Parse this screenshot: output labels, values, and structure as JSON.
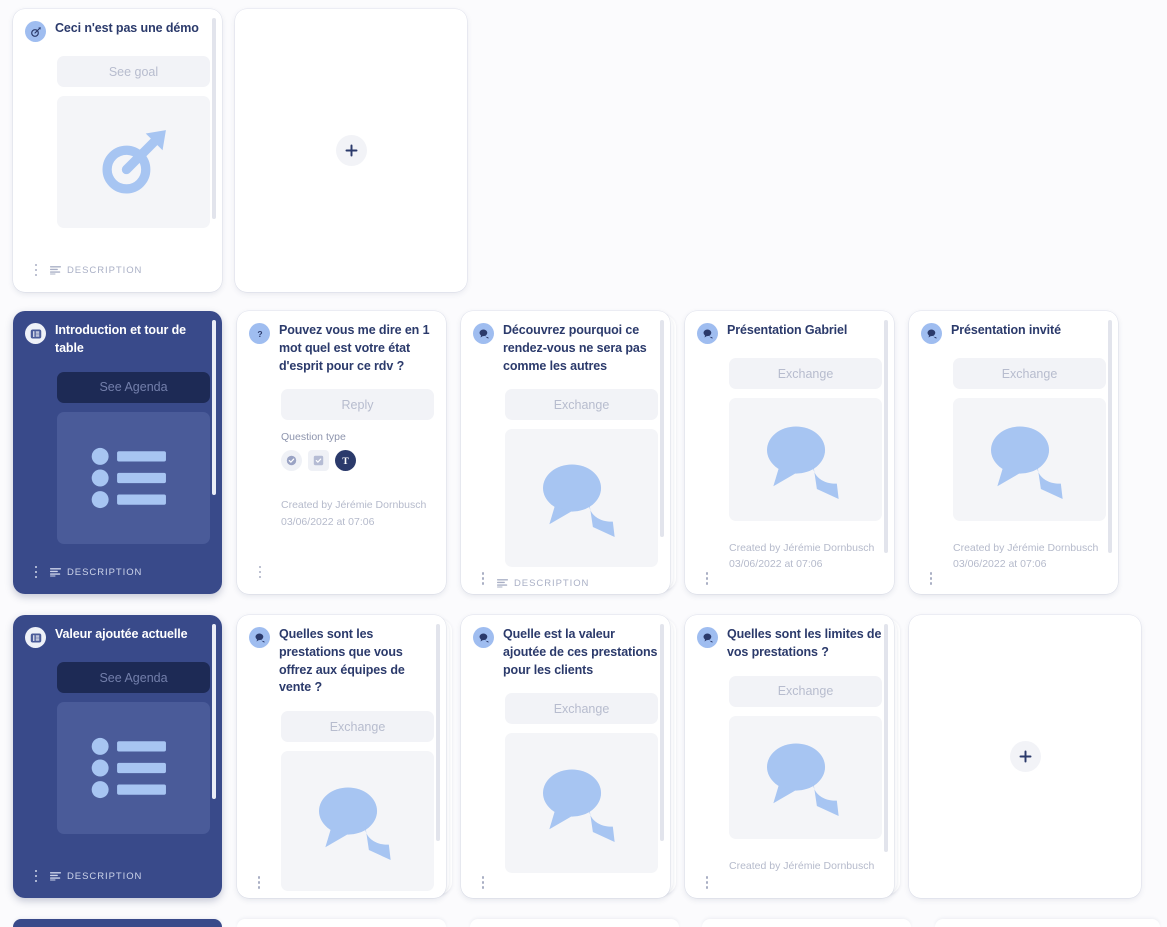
{
  "theme": {
    "page_bg": "#fbfbfd",
    "card_bg": "#ffffff",
    "dark_card_bg": "#394a8a",
    "title_color": "#2b3a6b",
    "accent_light_blue": "#9fbdf0",
    "muted_text": "#b5bacb"
  },
  "labels": {
    "description": "DESCRIPTION",
    "question_type": "Question type",
    "add": "+"
  },
  "rows": [
    {
      "cards": [
        {
          "kind": "goal",
          "theme": "light",
          "icon": "target-icon",
          "title": "Ceci n'est pas une démo",
          "button": "See goal",
          "illustration": "target-illustration",
          "footer": "DESCRIPTION",
          "stacked": false,
          "scroll_thumb": {
            "top_pct": 0,
            "height_pct": 76
          }
        },
        {
          "kind": "empty",
          "theme": "light",
          "add_label": "+"
        }
      ]
    },
    {
      "cards": [
        {
          "kind": "agenda",
          "theme": "dark",
          "icon": "list-icon",
          "title": "Introduction et tour de table",
          "button": "See Agenda",
          "illustration": "list-illustration",
          "footer": "DESCRIPTION",
          "stacked": false,
          "scroll_thumb": {
            "top_pct": 0,
            "height_pct": 66
          }
        },
        {
          "kind": "question",
          "theme": "light",
          "icon": "question-icon",
          "title": "Pouvez vous me dire en 1 mot quel est votre état d'esprit pour ce rdv ?",
          "button": "Reply",
          "question_type_label": "Question type",
          "question_types": [
            {
              "name": "single-choice-icon",
              "selected": false
            },
            {
              "name": "multiple-choice-icon",
              "selected": false
            },
            {
              "name": "free-text-icon",
              "selected": true,
              "glyph": "T"
            }
          ],
          "meta": "Created by Jérémie Dornbusch\n03/06/2022 at 07:06",
          "stacked": false
        },
        {
          "kind": "exchange",
          "theme": "light",
          "icon": "exchange-icon",
          "title": "Découvrez pourquoi ce rendez-vous ne sera pas comme les autres",
          "button": "Exchange",
          "illustration": "chat-illustration",
          "footer": "DESCRIPTION",
          "clipped_footer": true,
          "stacked": true,
          "scroll_thumb": {
            "top_pct": 0,
            "height_pct": 82
          }
        },
        {
          "kind": "exchange",
          "theme": "light",
          "icon": "exchange-icon",
          "title": "Présentation Gabriel",
          "button": "Exchange",
          "illustration": "chat-illustration",
          "meta": "Created by Jérémie Dornbusch\n03/06/2022 at 07:06",
          "clipped_meta": true,
          "stacked": false,
          "scroll_thumb": {
            "top_pct": 0,
            "height_pct": 88
          }
        },
        {
          "kind": "exchange",
          "theme": "light",
          "icon": "exchange-icon",
          "title": "Présentation invité",
          "button": "Exchange",
          "illustration": "chat-illustration",
          "meta": "Created by Jérémie Dornbusch\n03/06/2022 at 07:06",
          "clipped_meta": true,
          "stacked": false,
          "scroll_thumb": {
            "top_pct": 0,
            "height_pct": 88
          }
        }
      ]
    },
    {
      "cards": [
        {
          "kind": "agenda",
          "theme": "dark",
          "icon": "list-icon",
          "title": "Valeur ajoutée actuelle",
          "button": "See Agenda",
          "illustration": "list-illustration",
          "footer": "DESCRIPTION",
          "stacked": false,
          "scroll_thumb": {
            "top_pct": 0,
            "height_pct": 66
          }
        },
        {
          "kind": "exchange",
          "theme": "light",
          "icon": "exchange-icon",
          "title": "Quelles sont les prestations que vous offrez aux équipes de vente ?",
          "button": "Exchange",
          "illustration": "chat-illustration",
          "stacked": true,
          "scroll_thumb": {
            "top_pct": 0,
            "height_pct": 82
          }
        },
        {
          "kind": "exchange",
          "theme": "light",
          "icon": "exchange-icon",
          "title": "Quelle est la valeur ajoutée de ces prestations pour les clients",
          "button": "Exchange",
          "illustration": "chat-illustration",
          "stacked": true,
          "scroll_thumb": {
            "top_pct": 0,
            "height_pct": 82
          }
        },
        {
          "kind": "exchange",
          "theme": "light",
          "icon": "exchange-icon",
          "title": "Quelles sont les limites de vos prestations ?",
          "button": "Exchange",
          "illustration": "chat-illustration",
          "meta": "Created by Jérémie Dornbusch",
          "clipped_meta": true,
          "stacked": true,
          "scroll_thumb": {
            "top_pct": 0,
            "height_pct": 86
          }
        },
        {
          "kind": "empty",
          "theme": "light",
          "add_label": "+"
        }
      ]
    }
  ],
  "bottom_row_partial": {
    "visible": true,
    "cards": [
      "dark",
      "light",
      "light",
      "light"
    ]
  }
}
